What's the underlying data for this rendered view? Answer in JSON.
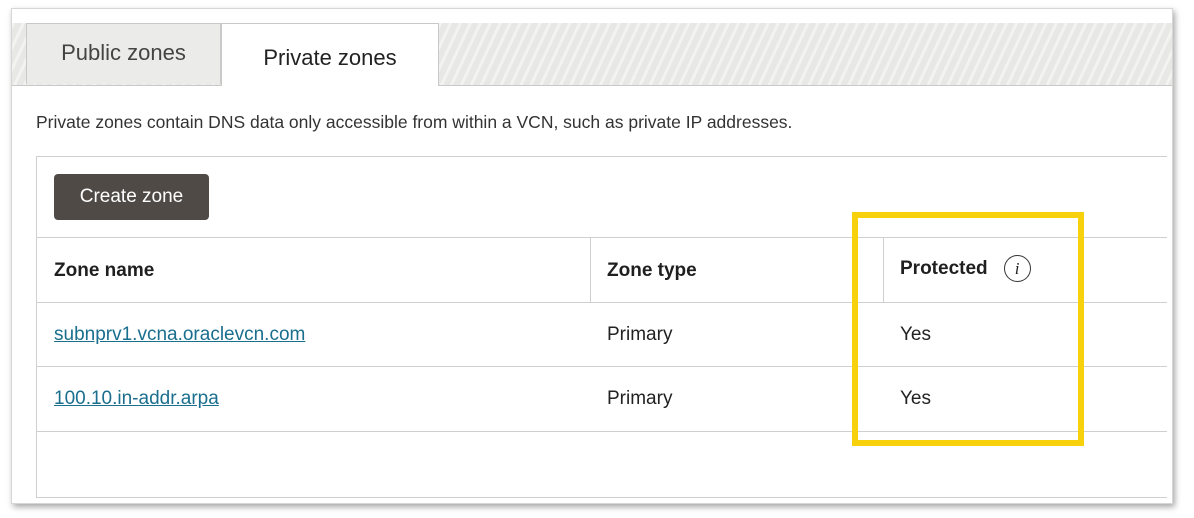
{
  "tabs": {
    "public_label": "Public zones",
    "private_label": "Private zones"
  },
  "description": "Private zones contain DNS data only accessible from within a VCN, such as private IP addresses.",
  "toolbar": {
    "create_label": "Create zone"
  },
  "table": {
    "headers": {
      "zone_name": "Zone name",
      "zone_type": "Zone type",
      "protected": "Protected"
    },
    "info_icon_glyph": "i",
    "rows": [
      {
        "zone_name": "subnprv1.vcna.oraclevcn.com",
        "zone_type": "Primary",
        "protected": "Yes"
      },
      {
        "zone_name": "100.10.in-addr.arpa",
        "zone_type": "Primary",
        "protected": "Yes"
      }
    ]
  },
  "colors": {
    "highlight": "#f7d10c",
    "button_bg": "#4f4a46",
    "link": "#1a6e8e"
  },
  "icons": [
    "info-icon"
  ]
}
